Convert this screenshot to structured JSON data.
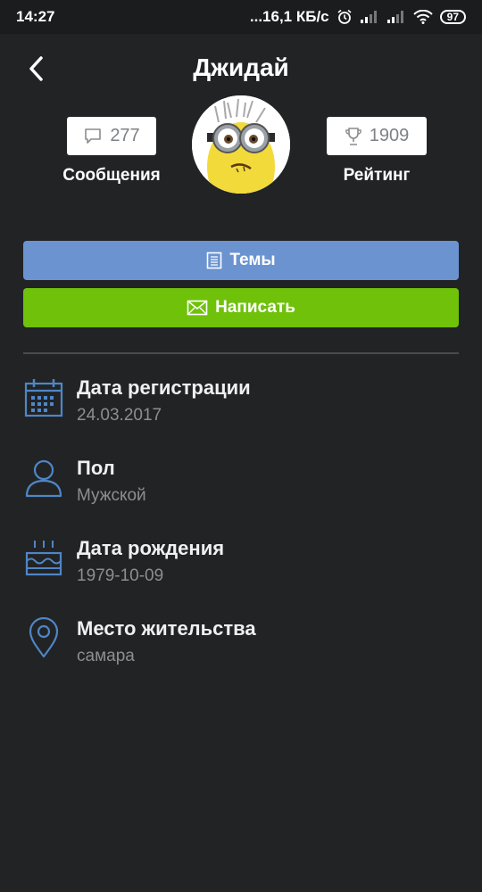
{
  "status_bar": {
    "time": "14:27",
    "network": "...16,1 КБ/с",
    "battery": "97"
  },
  "header": {
    "title": "Джидай"
  },
  "stats": {
    "messages_count": "277",
    "messages_label": "Сообщения",
    "rating_count": "1909",
    "rating_label": "Рейтинг"
  },
  "buttons": {
    "topics_label": "Темы",
    "write_label": "Написать"
  },
  "info": {
    "items": [
      {
        "icon": "calendar-icon",
        "title": "Дата регистрации",
        "value": "24.03.2017"
      },
      {
        "icon": "person-icon",
        "title": "Пол",
        "value": "Мужской"
      },
      {
        "icon": "cake-icon",
        "title": "Дата рождения",
        "value": "1979-10-09"
      },
      {
        "icon": "location-pin-icon",
        "title": "Место жительства",
        "value": "самара"
      }
    ]
  },
  "colors": {
    "background": "#222325",
    "topics_button": "#6a93d0",
    "write_button": "#6fc10a",
    "icon_blue": "#4f86c6"
  }
}
